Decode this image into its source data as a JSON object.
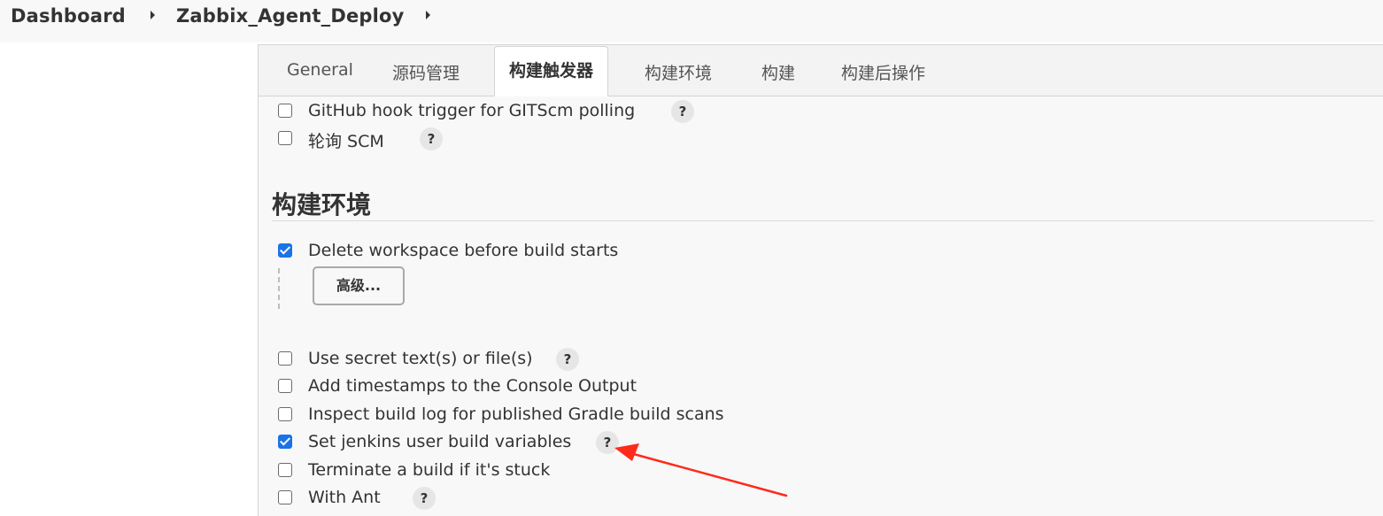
{
  "breadcrumb": {
    "items": [
      "Dashboard",
      "Zabbix_Agent_Deploy"
    ]
  },
  "tabs": [
    {
      "label": "General",
      "active": false
    },
    {
      "label": "源码管理",
      "active": false
    },
    {
      "label": "构建触发器",
      "active": true
    },
    {
      "label": "构建环境",
      "active": false
    },
    {
      "label": "构建",
      "active": false
    },
    {
      "label": "构建后操作",
      "active": false
    }
  ],
  "triggers": [
    {
      "label": "GitHub hook trigger for GITScm polling",
      "checked": false,
      "help": "?"
    },
    {
      "label": "轮询 SCM",
      "checked": false,
      "help": "?"
    }
  ],
  "build_env": {
    "title": "构建环境",
    "delete_workspace": {
      "label": "Delete workspace before build starts",
      "checked": true
    },
    "advanced_button": "高级...",
    "options": [
      {
        "label": "Use secret text(s) or file(s)",
        "checked": false,
        "help": "?"
      },
      {
        "label": "Add timestamps to the Console Output",
        "checked": false
      },
      {
        "label": "Inspect build log for published Gradle build scans",
        "checked": false
      },
      {
        "label": "Set jenkins user build variables",
        "checked": true,
        "help": "?"
      },
      {
        "label": "Terminate a build if it's stuck",
        "checked": false
      },
      {
        "label": "With Ant",
        "checked": false,
        "help": "?"
      }
    ]
  },
  "colors": {
    "checkbox_checked": "#1a73e8",
    "annotation_arrow": "#ff2a1a"
  },
  "icons": {
    "breadcrumb_separator": "caret-right-icon",
    "help": "help-icon",
    "annotation": "red-arrow-annotation"
  }
}
